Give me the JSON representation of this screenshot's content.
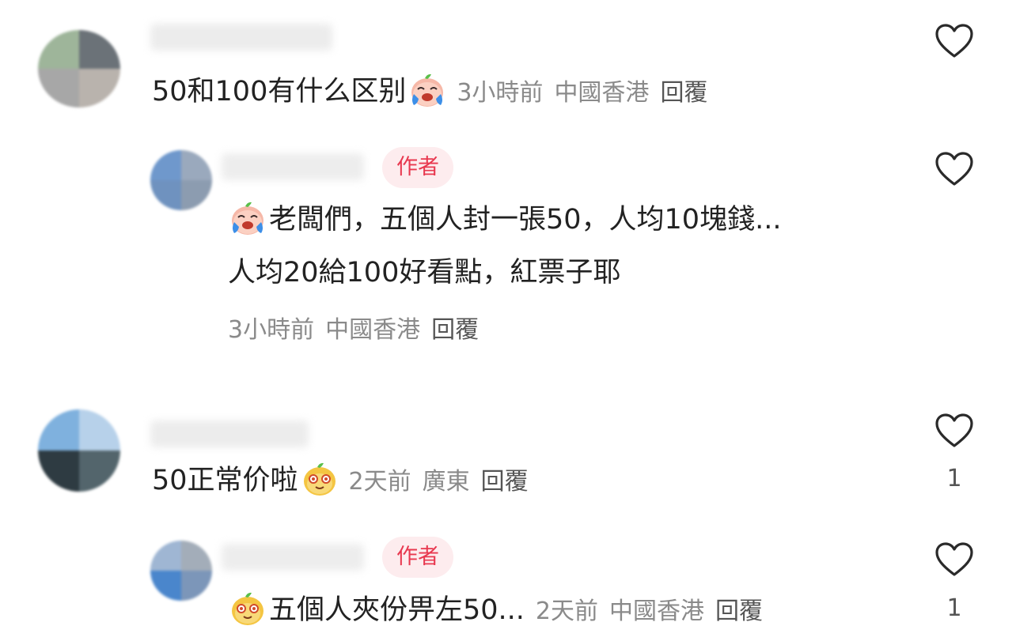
{
  "comments": [
    {
      "text": "50和100有什么区别",
      "emoji": "crying-laughing-emoji",
      "time": "3小時前",
      "location": "中國香港",
      "reply_label": "回覆",
      "likes": ""
    },
    {
      "author_badge": "作者",
      "text_line1": "老闆們，五個人封一張50，人均10塊錢...",
      "text_line2": "人均20給100好看點，紅票子耶",
      "emoji": "crying-laughing-emoji",
      "time": "3小時前",
      "location": "中國香港",
      "reply_label": "回覆",
      "likes": ""
    },
    {
      "text": "50正常价啦",
      "emoji": "smug-face-emoji",
      "time": "2天前",
      "location": "廣東",
      "reply_label": "回覆",
      "likes": "1"
    },
    {
      "author_badge": "作者",
      "text": "五個人夾份畀左50...",
      "emoji": "smug-face-emoji",
      "time": "2天前",
      "location": "中國香港",
      "reply_label": "回覆",
      "likes": "1"
    }
  ],
  "colors": {
    "badge_text": "#e8384f",
    "badge_bg": "#fdecee",
    "meta_text": "#8a8a8a",
    "main_text": "#222222"
  }
}
